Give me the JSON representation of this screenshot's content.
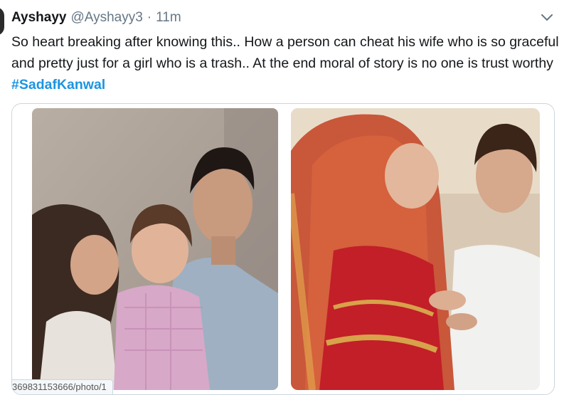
{
  "tweet": {
    "display_name": "Ayshayy",
    "handle": "@Ayshayy3",
    "separator": "·",
    "timestamp": "11m",
    "menu_icon": "chevron-down-icon",
    "text": "So heart breaking after knowing this.. How a person can cheat his wife who is so graceful and pretty just for  a girl who is a trash.. At the  end moral of story is no one is trust worthy ",
    "hashtag": "#SadafKanwal"
  },
  "status_bar": {
    "url": "369831153666/photo/1"
  },
  "colors": {
    "hashtag": "#1b95e0",
    "secondary_text": "#657786",
    "border": "#ccd6dd"
  }
}
